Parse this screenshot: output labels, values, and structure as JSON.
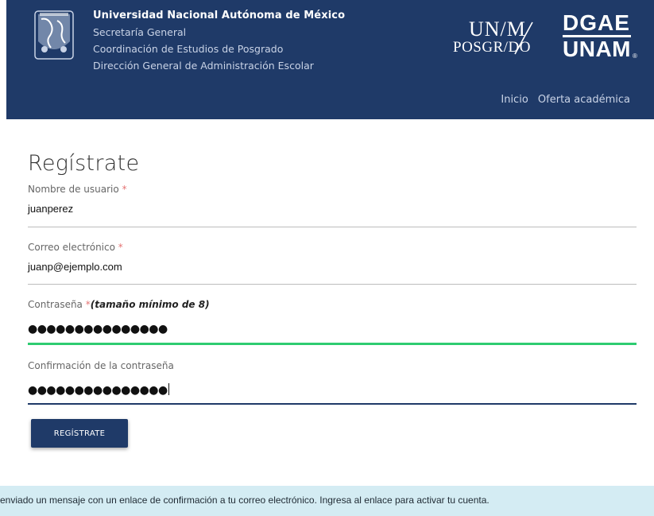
{
  "header": {
    "institution": "Universidad Nacional Autónoma de México",
    "lines": [
      "Secretaría General",
      "Coordinación de Estudios de Posgrado",
      "Dirección General de Administración Escolar"
    ],
    "logo_posgrado": {
      "top": "UN/M",
      "bottom": "POSGR/DO"
    },
    "logo_dgae": {
      "top": "DGAE",
      "bottom": "UNAM",
      "mark": "®"
    },
    "nav": [
      {
        "label": "Inicio"
      },
      {
        "label": "Oferta académica"
      }
    ],
    "colors": {
      "background": "#1f3a68",
      "text": "#ffffff",
      "muted": "#c9d3e6"
    }
  },
  "form": {
    "title": "Regístrate",
    "fields": [
      {
        "label": "Nombre de usuario",
        "required": "*",
        "value": "juanperez"
      },
      {
        "label": "Correo electrónico",
        "required": "*",
        "value": "juanp@ejemplo.com"
      },
      {
        "label": "Contraseña",
        "required": "*",
        "hint": "(tamaño mínimo de 8)",
        "masked_value": "●●●●●●●●●●●●●●●",
        "status_color": "#2ecc71"
      },
      {
        "label": "Confirmación de la contraseña",
        "masked_value": "●●●●●●●●●●●●●●●",
        "focus_color": "#1f3a68"
      }
    ],
    "submit_label": "REGÍSTRATE"
  },
  "alert": {
    "message": "enviado un mensaje con un enlace de confirmación a tu correo electrónico. Ingresa al enlace para activar tu cuenta.",
    "background": "#d4ecf3"
  }
}
